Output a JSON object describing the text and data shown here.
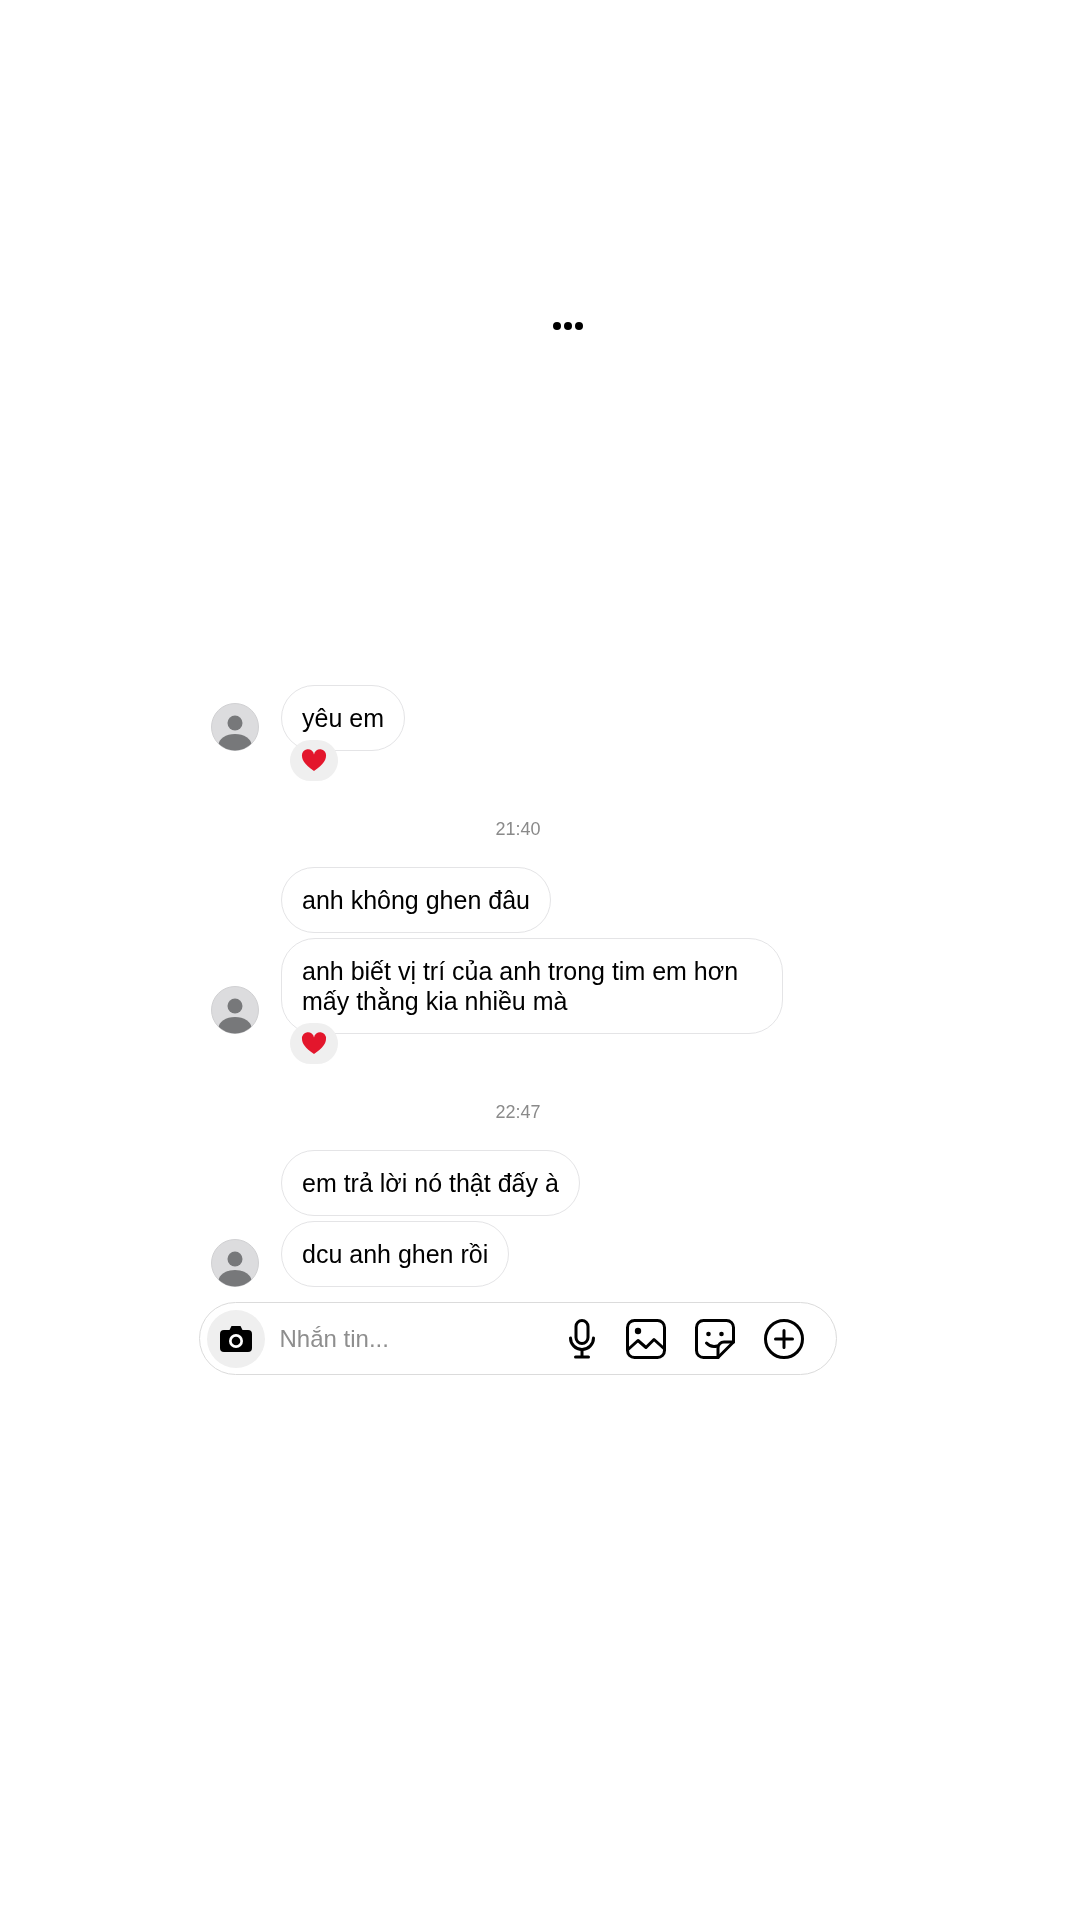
{
  "thread": [
    {
      "kind": "group",
      "messages": [
        {
          "text": "yêu em",
          "reacted": true
        }
      ]
    },
    {
      "kind": "timestamp",
      "text": "21:40"
    },
    {
      "kind": "group",
      "messages": [
        {
          "text": "anh không ghen đâu",
          "reacted": false
        },
        {
          "text": "anh biết vị trí của anh trong tim em hơn mấy thằng kia nhiều mà",
          "reacted": true
        }
      ]
    },
    {
      "kind": "timestamp",
      "text": "22:47"
    },
    {
      "kind": "group",
      "messages": [
        {
          "text": "em trả lời nó thật đấy à",
          "reacted": false
        },
        {
          "text": "dcu anh ghen rồi",
          "reacted": false
        }
      ]
    }
  ],
  "composer": {
    "placeholder": "Nhắn tin..."
  }
}
